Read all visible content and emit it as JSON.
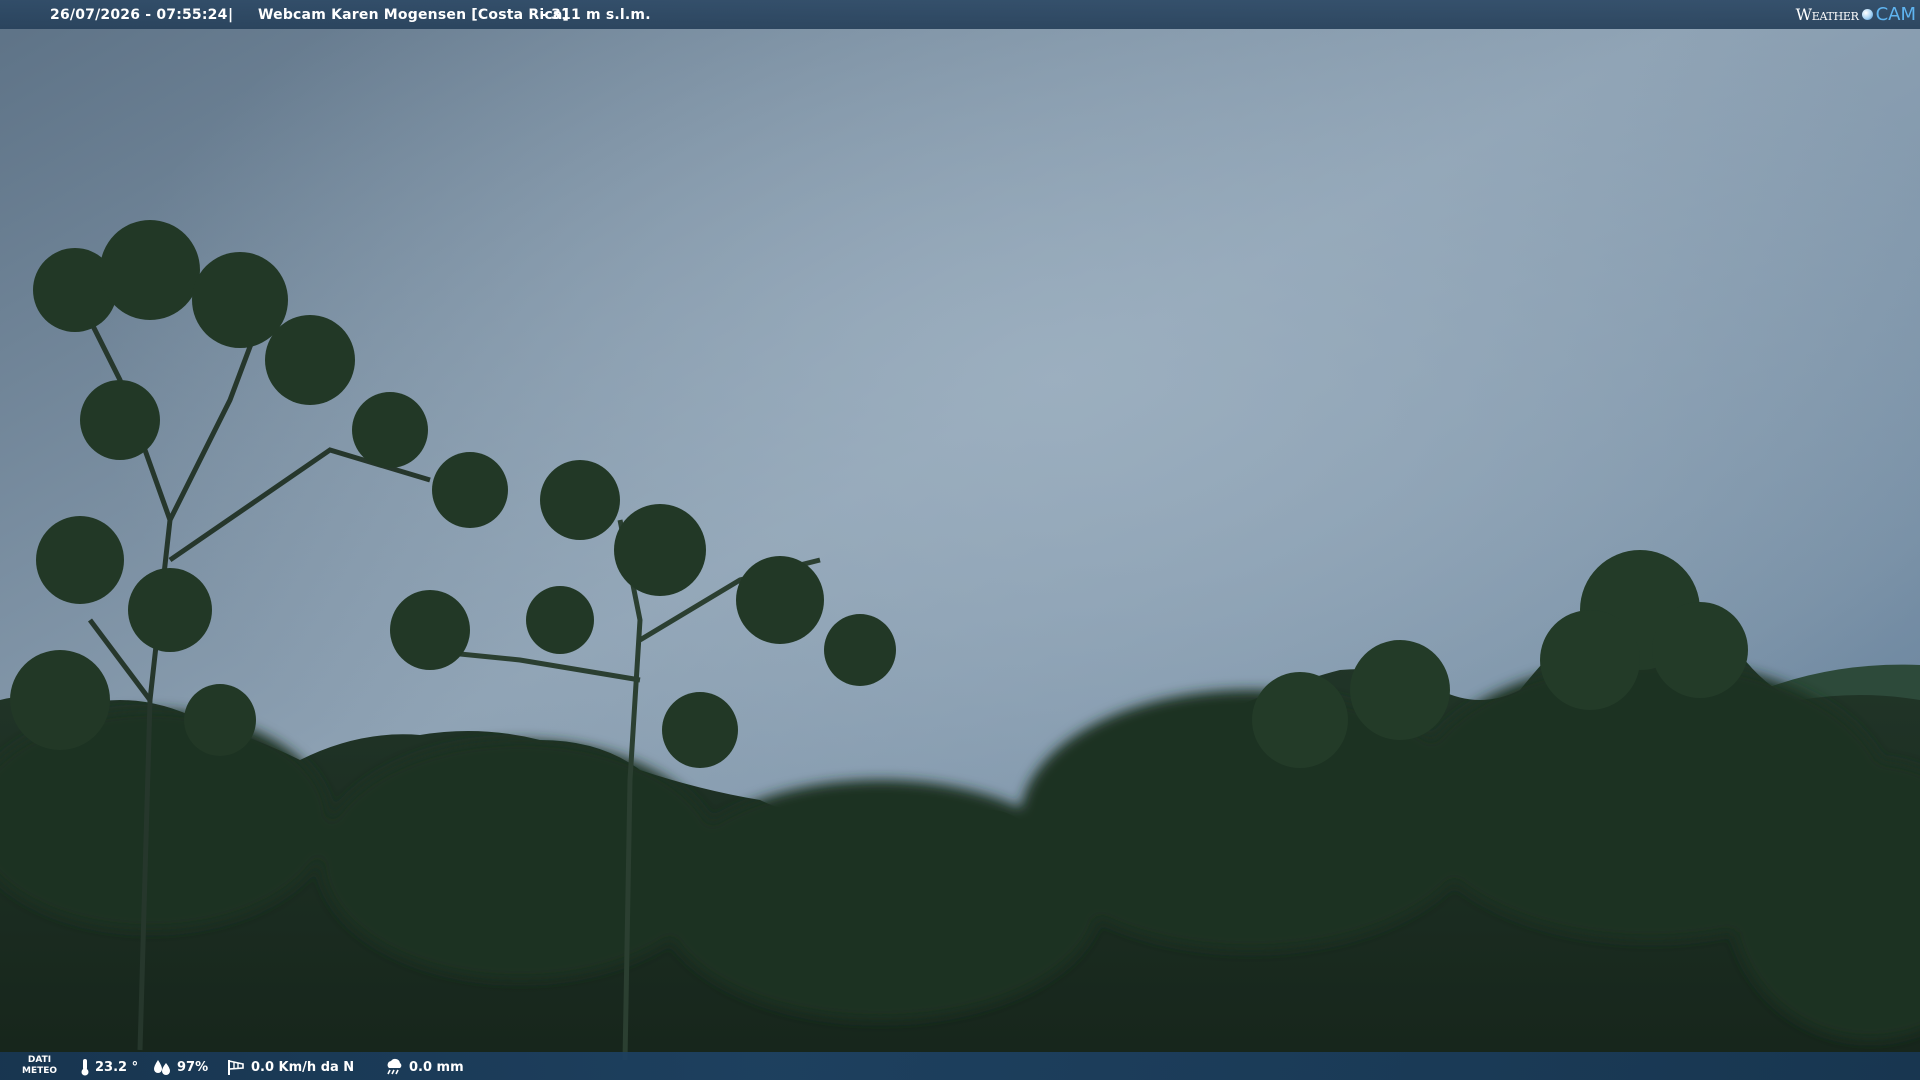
{
  "header": {
    "timestamp": "26/07/2026 - 07:55:24",
    "separator": "|",
    "webcam_title": "Webcam Karen Mogensen [Costa Rica]",
    "altitude": "- 311 m s.l.m."
  },
  "brand": {
    "word": "Weather",
    "mark": "CAM",
    "accent_color": "#5fb4f0"
  },
  "weather": {
    "section_label_line1": "DATI",
    "section_label_line2": "METEO",
    "temperature": "23.2 °",
    "humidity": "97%",
    "wind": "0.0 Km/h da N",
    "rain": "0.0 mm",
    "icons": {
      "temperature": "thermometer-icon",
      "humidity": "humidity-drops-icon",
      "wind": "windsock-icon",
      "rain": "rain-cloud-icon"
    }
  },
  "scene": {
    "sky_color": "#7d93a6",
    "foliage_color": "#1f3322"
  }
}
